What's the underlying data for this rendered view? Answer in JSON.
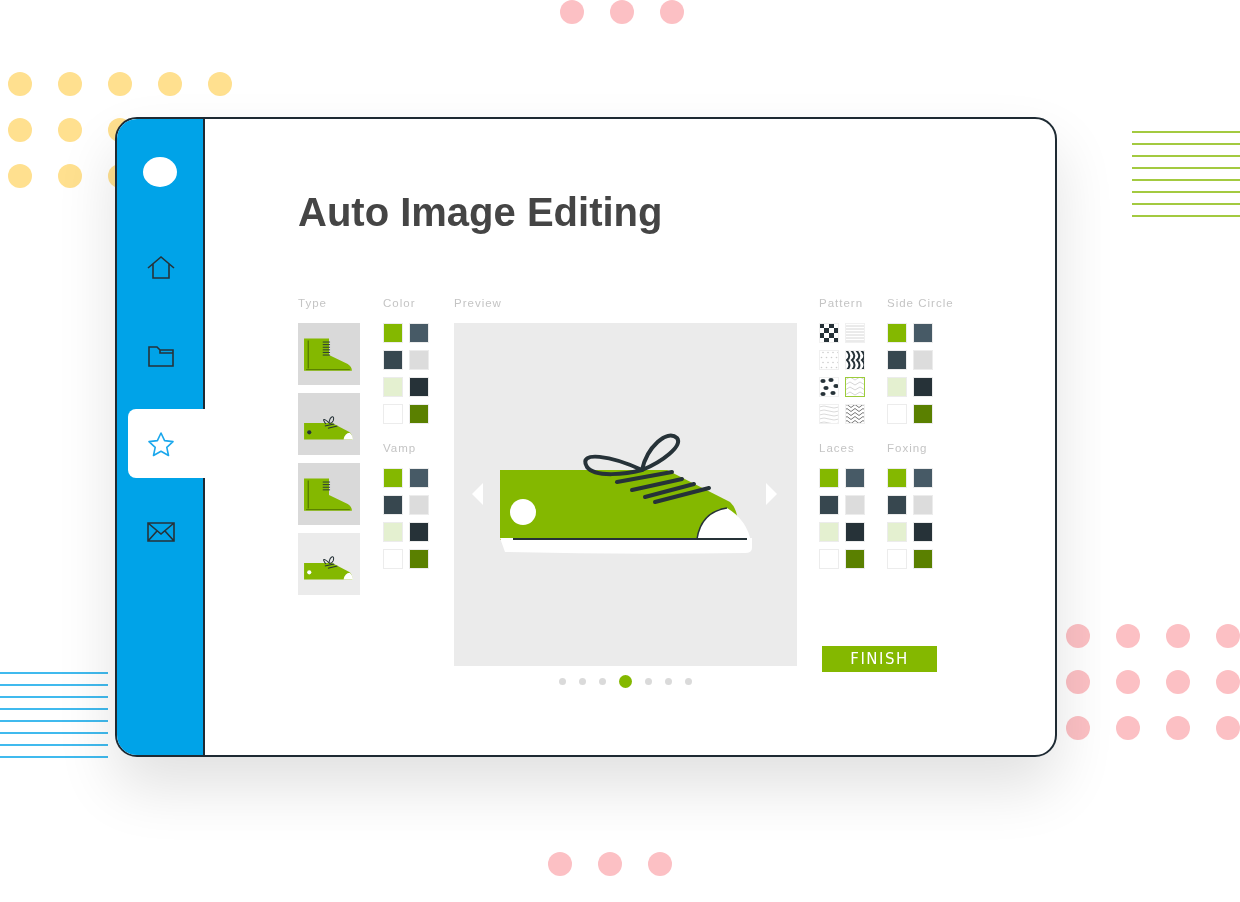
{
  "title": "Auto Image Editing",
  "sidebar": {
    "items": [
      {
        "kind": "home",
        "selected": false
      },
      {
        "kind": "folder",
        "selected": false
      },
      {
        "kind": "star",
        "selected": true
      },
      {
        "kind": "mail",
        "selected": false
      }
    ]
  },
  "type_panel": {
    "label": "Type",
    "items": [
      {
        "kind": "high-laced",
        "selected": false
      },
      {
        "kind": "low-laced",
        "selected": false
      },
      {
        "kind": "high",
        "selected": false
      },
      {
        "kind": "low",
        "selected": true
      }
    ]
  },
  "palettes_left": [
    {
      "label": "Color",
      "swatches": [
        {
          "color": "#84b800"
        },
        {
          "color": "#475a66"
        },
        {
          "color": "#37474f"
        },
        {
          "color": "#dcdcdc"
        },
        {
          "color": "#e4f0d0"
        },
        {
          "color": "#263238"
        },
        {
          "color": "#ffffff"
        },
        {
          "color": "#5a8000"
        }
      ]
    },
    {
      "label": "Vamp",
      "swatches": [
        {
          "color": "#84b800"
        },
        {
          "color": "#475a66"
        },
        {
          "color": "#37474f"
        },
        {
          "color": "#dcdcdc"
        },
        {
          "color": "#e4f0d0"
        },
        {
          "color": "#263238"
        },
        {
          "color": "#ffffff"
        },
        {
          "color": "#5a8000"
        }
      ]
    }
  ],
  "preview": {
    "label": "Preview",
    "pages": [
      {
        "selected": false
      },
      {
        "selected": false
      },
      {
        "selected": false
      },
      {
        "selected": true
      },
      {
        "selected": false
      },
      {
        "selected": false
      },
      {
        "selected": false
      }
    ]
  },
  "pattern": {
    "label": "Pattern",
    "items": [
      {
        "kind": "checker",
        "selected": false
      },
      {
        "kind": "stripes",
        "selected": false
      },
      {
        "kind": "dots",
        "selected": false
      },
      {
        "kind": "zebra",
        "selected": false
      },
      {
        "kind": "leopard",
        "selected": false
      },
      {
        "kind": "zigzag",
        "selected": true
      },
      {
        "kind": "waves",
        "selected": false
      },
      {
        "kind": "scribble",
        "selected": false
      }
    ]
  },
  "palettes_right": [
    {
      "label": "Side Circle",
      "swatches": [
        {
          "color": "#84b800"
        },
        {
          "color": "#475a66"
        },
        {
          "color": "#37474f"
        },
        {
          "color": "#dcdcdc"
        },
        {
          "color": "#e4f0d0"
        },
        {
          "color": "#263238"
        },
        {
          "color": "#ffffff"
        },
        {
          "color": "#5a8000"
        }
      ]
    },
    {
      "label": "Laces",
      "swatches": [
        {
          "color": "#84b800"
        },
        {
          "color": "#475a66"
        },
        {
          "color": "#37474f"
        },
        {
          "color": "#dcdcdc"
        },
        {
          "color": "#e4f0d0"
        },
        {
          "color": "#263238"
        },
        {
          "color": "#ffffff"
        },
        {
          "color": "#5a8000"
        }
      ]
    },
    {
      "label": "Foxing",
      "swatches": [
        {
          "color": "#84b800"
        },
        {
          "color": "#475a66"
        },
        {
          "color": "#37474f"
        },
        {
          "color": "#dcdcdc"
        },
        {
          "color": "#e4f0d0"
        },
        {
          "color": "#263238"
        },
        {
          "color": "#ffffff"
        },
        {
          "color": "#5a8000"
        }
      ]
    }
  ],
  "finish_button": "FINISH"
}
